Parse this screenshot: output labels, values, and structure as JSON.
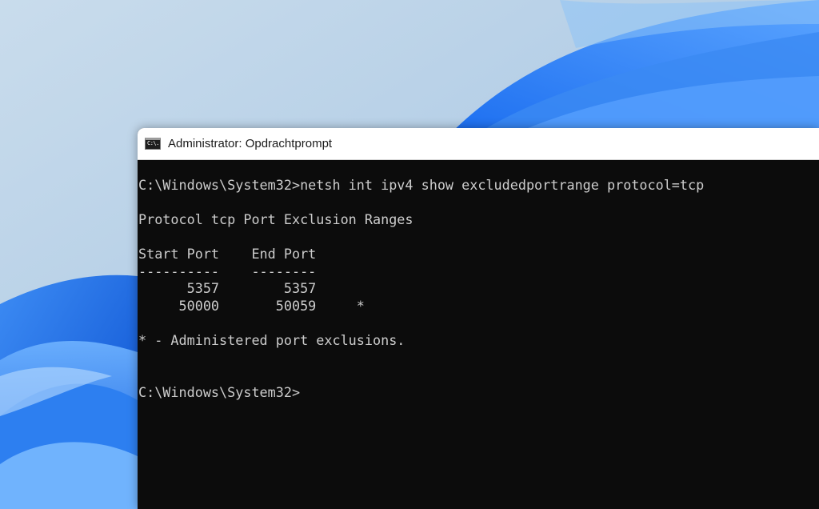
{
  "window": {
    "title": "Administrator: Opdrachtprompt",
    "icon": "cmd-icon",
    "icon_text": "C:\\."
  },
  "console": {
    "lines": [
      "C:\\Windows\\System32>netsh int ipv4 show excludedportrange protocol=tcp",
      "Protocol tcp Port Exclusion Ranges",
      "Start Port    End Port",
      "----------    --------",
      "      5357        5357",
      "     50000       50059     *",
      "* - Administered port exclusions.",
      "C:\\Windows\\System32>"
    ]
  },
  "colors": {
    "console_background": "#0c0c0c",
    "console_text": "#cccccc",
    "titlebar_background": "#ffffff",
    "desktop_background": "#aac8e2",
    "wallpaper_accent": "#1f6fe6"
  }
}
